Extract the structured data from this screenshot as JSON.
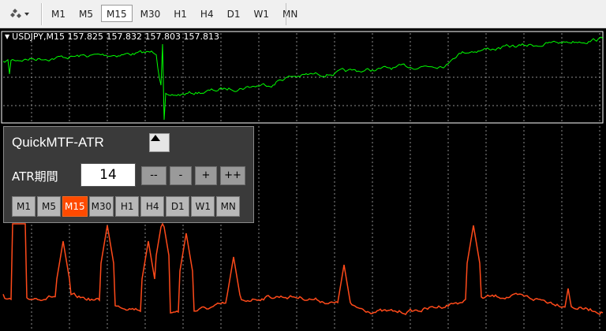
{
  "toolbar": {
    "tool_icon": "cursor-tools-icon",
    "timeframes": [
      "M1",
      "M5",
      "M15",
      "M30",
      "H1",
      "H4",
      "D1",
      "W1",
      "MN"
    ],
    "active_timeframe": "M15"
  },
  "chart": {
    "symbol_info": "USDJPY,M15  157.825 157.832 157.803 157.813",
    "price_color": "#00ff00",
    "atr_color": "#ff4a1a",
    "grid_color": "#8c8c8c"
  },
  "panel": {
    "title": "QuickMTF-ATR",
    "collapse_icon": "triangle-up-icon",
    "atr_label": "ATR期間",
    "atr_value": "14",
    "buttons": {
      "dec_big": "--",
      "dec": "-",
      "inc": "+",
      "inc_big": "++"
    },
    "timeframes": [
      "M1",
      "M5",
      "M15",
      "M30",
      "H1",
      "H4",
      "D1",
      "W1",
      "MN"
    ],
    "active_timeframe": "M15",
    "accent": "#ff4a00"
  }
}
